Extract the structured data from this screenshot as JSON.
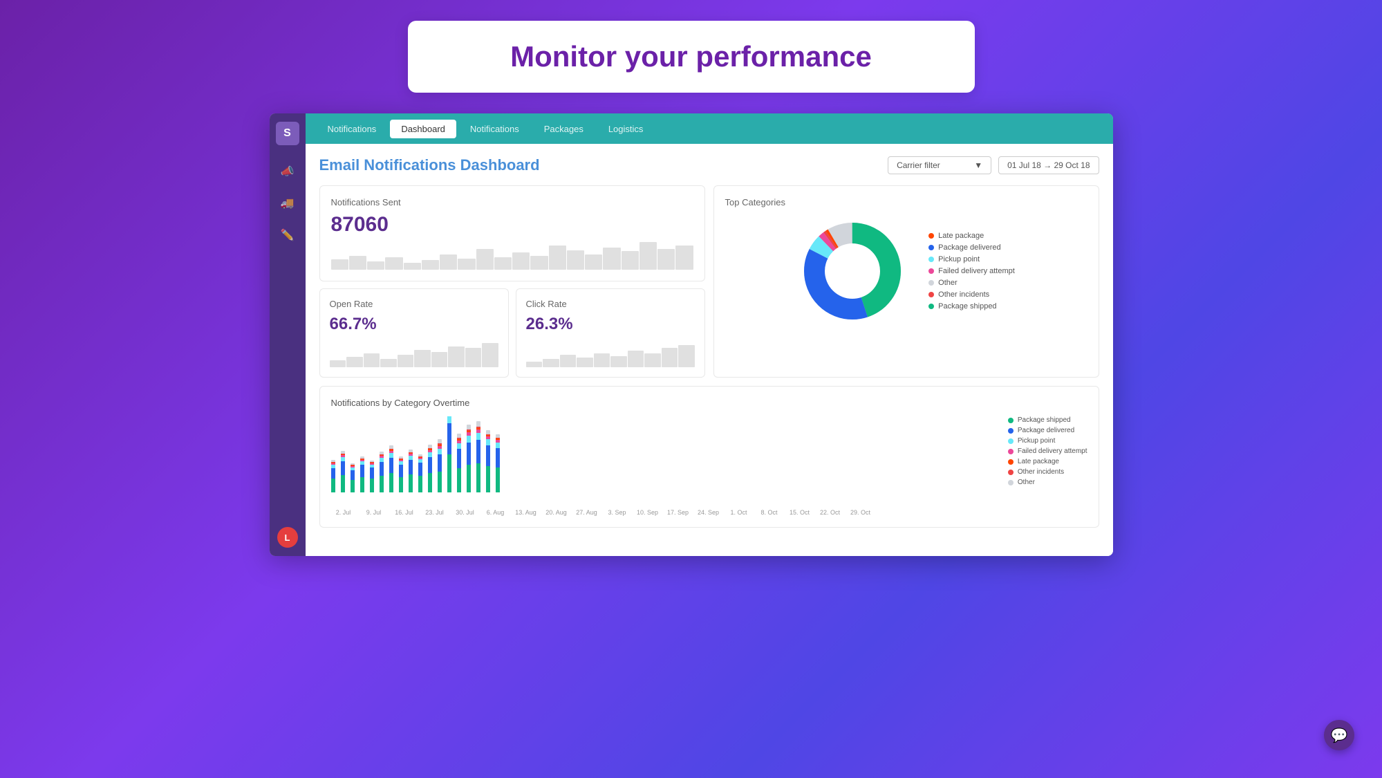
{
  "header": {
    "title": "Monitor your performance"
  },
  "nav": {
    "items": [
      {
        "label": "Notifications",
        "active": false
      },
      {
        "label": "Dashboard",
        "active": true
      },
      {
        "label": "Notifications",
        "active": false
      },
      {
        "label": "Packages",
        "active": false
      },
      {
        "label": "Logistics",
        "active": false
      }
    ]
  },
  "sidebar": {
    "logo": "S",
    "icons": [
      "📣",
      "🚚",
      "✏️"
    ],
    "avatar": "L"
  },
  "dashboard": {
    "title": "Email Notifications Dashboard",
    "carrier_filter_label": "Carrier filter",
    "date_range": "01 Jul 18  →  29 Oct 18",
    "notifications_sent": {
      "label": "Notifications Sent",
      "value": "87060"
    },
    "open_rate": {
      "label": "Open Rate",
      "value": "66.7%"
    },
    "click_rate": {
      "label": "Click Rate",
      "value": "26.3%"
    },
    "top_categories": {
      "title": "Top Categories",
      "legend": [
        {
          "label": "Late package",
          "color": "#FF4500"
        },
        {
          "label": "Package delivered",
          "color": "#2563EB"
        },
        {
          "label": "Pickup point",
          "color": "#67E8F9"
        },
        {
          "label": "Failed delivery attempt",
          "color": "#EC4899"
        },
        {
          "label": "Other",
          "color": "#D1D5DB"
        },
        {
          "label": "Other incidents",
          "color": "#EF4444"
        },
        {
          "label": "Package shipped",
          "color": "#10B981"
        }
      ]
    },
    "bar_chart": {
      "title": "Notifications by Category Overtime",
      "legend": [
        {
          "label": "Package shipped",
          "color": "#10B981"
        },
        {
          "label": "Package delivered",
          "color": "#2563EB"
        },
        {
          "label": "Pickup point",
          "color": "#67E8F9"
        },
        {
          "label": "Failed delivery attempt",
          "color": "#EC4899"
        },
        {
          "label": "Late package",
          "color": "#FF4500"
        },
        {
          "label": "Other incidents",
          "color": "#EF4444"
        },
        {
          "label": "Other",
          "color": "#D1D5DB"
        }
      ],
      "x_labels": [
        "2. Jul",
        "9. Jul",
        "16. Jul",
        "23. Jul",
        "30. Jul",
        "6. Aug",
        "13. Aug",
        "20. Aug",
        "27. Aug",
        "3. Sep",
        "10. Sep",
        "17. Sep",
        "24. Sep",
        "1. Oct",
        "8. Oct",
        "15. Oct",
        "22. Oct",
        "29. Oct"
      ]
    }
  }
}
